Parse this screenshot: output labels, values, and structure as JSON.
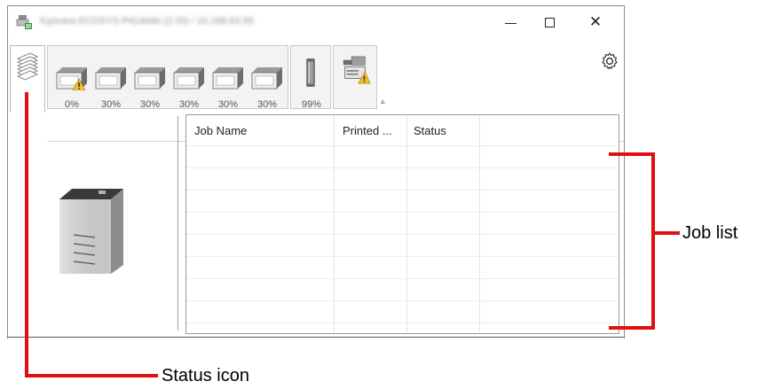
{
  "window": {
    "title": "Kyocera ECOSYS P4140dn (2-SS / 10.168.63.59",
    "controls": {
      "minimize_icon": "minimize-icon",
      "maximize_icon": "maximize-icon",
      "close_glyph": "✕"
    }
  },
  "toolbar": {
    "tray_levels": [
      "0%",
      "30%",
      "30%",
      "30%",
      "30%",
      "30%"
    ],
    "tray_warning": [
      true,
      false,
      false,
      false,
      false,
      false
    ],
    "toner_level": "99%",
    "collapse_glyph": "▵",
    "icons": [
      "status-icon",
      "paper-tray-icon",
      "toner-icon",
      "printer-warning-icon",
      "gear-icon"
    ]
  },
  "job_list": {
    "columns": [
      "Job Name",
      "Printed ...",
      "Status"
    ],
    "rows": []
  },
  "annotations": {
    "job_list_label": "Job list",
    "status_icon_label": "Status icon",
    "line_color": "#e01010"
  }
}
